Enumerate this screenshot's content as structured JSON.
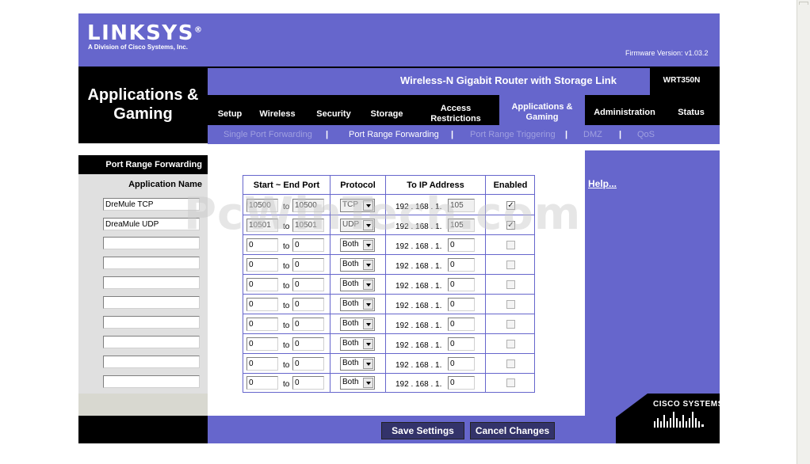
{
  "brand": {
    "logo": "LINKSYS",
    "registered": "®",
    "subtitle": "A Division of Cisco Systems, Inc.",
    "firmware": "Firmware Version: v1.03.2"
  },
  "header": {
    "section_line1": "Applications &",
    "section_line2": "Gaming",
    "product_name": "Wireless-N Gigabit Router with Storage Link",
    "model": "WRT350N"
  },
  "nav": {
    "tabs": [
      {
        "line1": "Setup",
        "line2": ""
      },
      {
        "line1": "Wireless",
        "line2": ""
      },
      {
        "line1": "Security",
        "line2": ""
      },
      {
        "line1": "Storage",
        "line2": ""
      },
      {
        "line1": "Access",
        "line2": "Restrictions"
      },
      {
        "line1": "Applications &",
        "line2": "Gaming"
      },
      {
        "line1": "Administration",
        "line2": ""
      },
      {
        "line1": "Status",
        "line2": ""
      }
    ],
    "active_tab": "Applications & Gaming",
    "subtabs": [
      "Single Port Forwarding",
      "Port Range Forwarding",
      "Port Range Triggering",
      "DMZ",
      "QoS"
    ],
    "active_subtab": "Port Range Forwarding",
    "separator": "|"
  },
  "left": {
    "page_label": "Port Range Forwarding",
    "app_name_header": "Application Name",
    "app_names": [
      "DreMule TCP",
      "DreaMule UDP",
      "",
      "",
      "",
      "",
      "",
      "",
      "",
      ""
    ]
  },
  "table": {
    "headers": [
      "Start ~ End Port",
      "Protocol",
      "To IP Address",
      "Enabled"
    ],
    "to_label": "to",
    "ip_prefix": "192 . 168 . 1.",
    "rows": [
      {
        "start": "10500",
        "end": "10500",
        "protocol": "TCP",
        "ip": "105",
        "enabled": true
      },
      {
        "start": "10501",
        "end": "10501",
        "protocol": "UDP",
        "ip": "105",
        "enabled": true
      },
      {
        "start": "0",
        "end": "0",
        "protocol": "Both",
        "ip": "0",
        "enabled": false
      },
      {
        "start": "0",
        "end": "0",
        "protocol": "Both",
        "ip": "0",
        "enabled": false
      },
      {
        "start": "0",
        "end": "0",
        "protocol": "Both",
        "ip": "0",
        "enabled": false
      },
      {
        "start": "0",
        "end": "0",
        "protocol": "Both",
        "ip": "0",
        "enabled": false
      },
      {
        "start": "0",
        "end": "0",
        "protocol": "Both",
        "ip": "0",
        "enabled": false
      },
      {
        "start": "0",
        "end": "0",
        "protocol": "Both",
        "ip": "0",
        "enabled": false
      },
      {
        "start": "0",
        "end": "0",
        "protocol": "Both",
        "ip": "0",
        "enabled": false
      },
      {
        "start": "0",
        "end": "0",
        "protocol": "Both",
        "ip": "0",
        "enabled": false
      }
    ]
  },
  "help": {
    "label": "Help..."
  },
  "footer": {
    "save_label": "Save Settings",
    "cancel_label": "Cancel Changes"
  },
  "cisco": {
    "text": "CISCO SYSTEMS"
  },
  "watermark": "PcWinTech.com",
  "colors": {
    "brand_purple": "#6666cc",
    "black": "#000000",
    "button": "#33336a"
  }
}
